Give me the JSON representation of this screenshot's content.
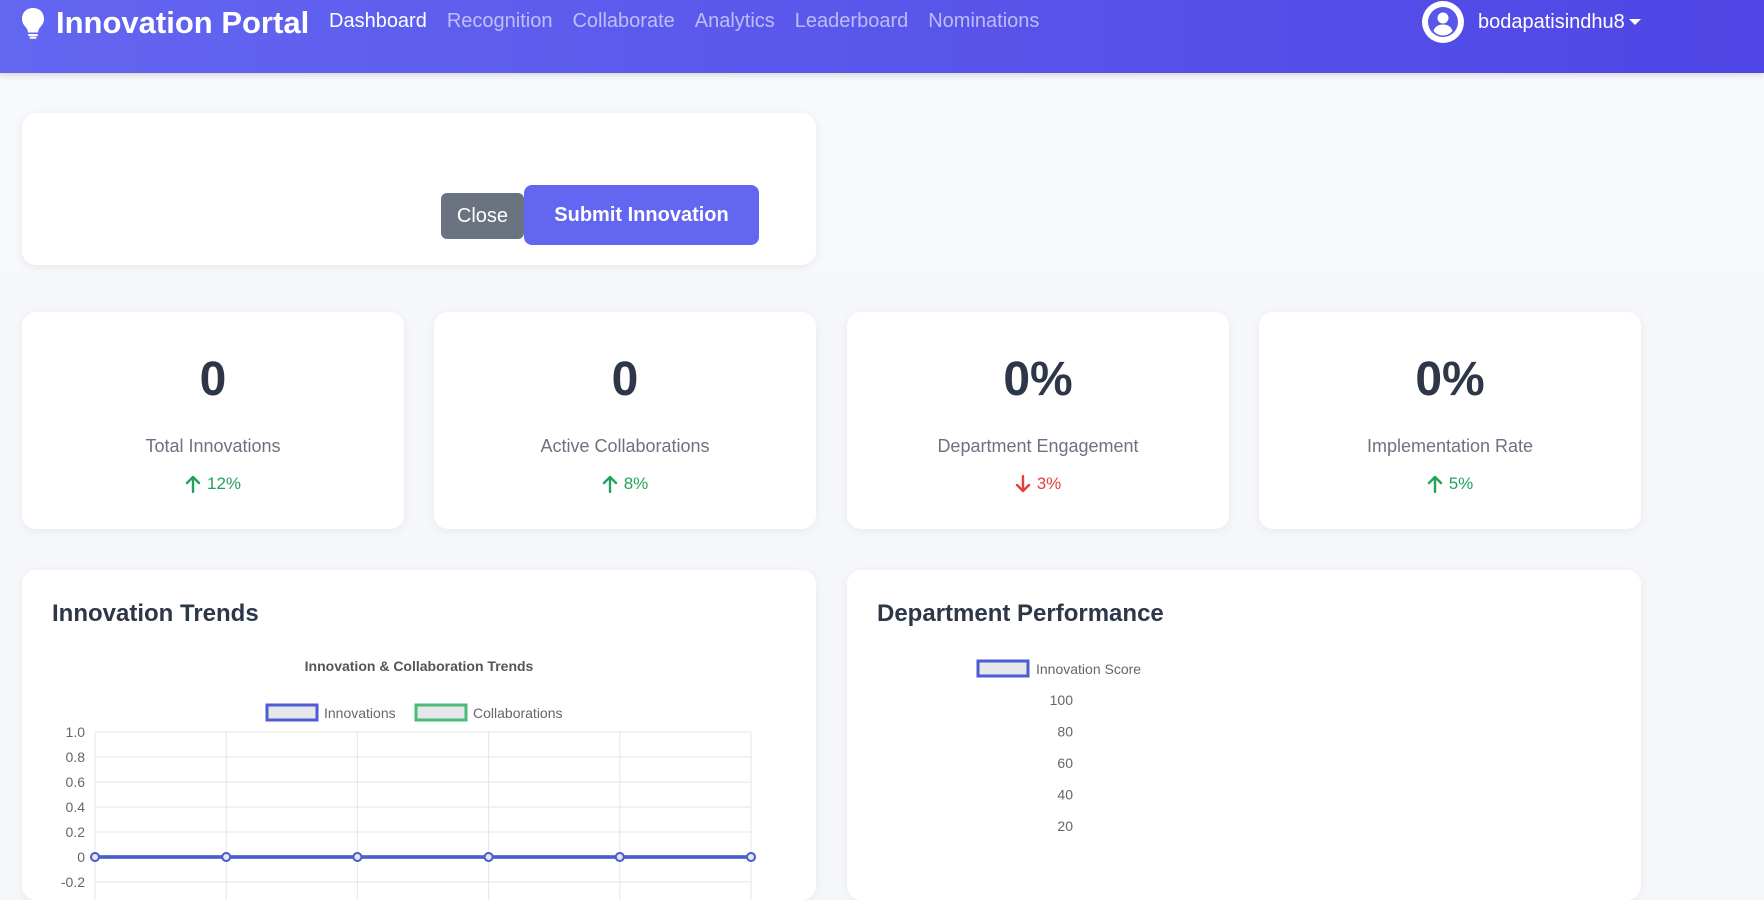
{
  "navbar": {
    "brand": "Innovation Portal",
    "links": [
      "Dashboard",
      "Recognition",
      "Collaborate",
      "Analytics",
      "Leaderboard",
      "Nominations"
    ],
    "active": "Dashboard",
    "username": "bodapatisindhu8"
  },
  "form": {
    "close_label": "Close",
    "submit_label": "Submit Innovation"
  },
  "stats": [
    {
      "value": "0",
      "label": "Total Innovations",
      "change": "12%",
      "direction": "up"
    },
    {
      "value": "0",
      "label": "Active Collaborations",
      "change": "8%",
      "direction": "up"
    },
    {
      "value": "0%",
      "label": "Department Engagement",
      "change": "3%",
      "direction": "down"
    },
    {
      "value": "0%",
      "label": "Implementation Rate",
      "change": "5%",
      "direction": "up"
    }
  ],
  "colors": {
    "accent": "#6366f1",
    "up": "#22a35a",
    "down": "#e53e3e",
    "innovations": "#4f5bd5",
    "collaborations": "#48bb78"
  },
  "trends_card": {
    "heading": "Innovation Trends"
  },
  "dept_card": {
    "heading": "Department Performance"
  },
  "chart_data": [
    {
      "type": "line",
      "title": "Innovation & Collaboration Trends",
      "xlabel": "",
      "ylabel": "",
      "ylim": [
        -0.2,
        1.0
      ],
      "yticks": [
        "1.0",
        "0.8",
        "0.6",
        "0.4",
        "0.2",
        "0",
        "-0.2"
      ],
      "x_count": 6,
      "series": [
        {
          "name": "Innovations",
          "values": [
            0,
            0,
            0,
            0,
            0,
            0
          ]
        },
        {
          "name": "Collaborations",
          "values": [
            0,
            0,
            0,
            0,
            0,
            0
          ]
        }
      ],
      "legend": "top",
      "grid": true
    },
    {
      "type": "bar",
      "title": "",
      "xlabel": "",
      "ylabel": "",
      "yticks": [
        "100",
        "80",
        "60",
        "40",
        "20"
      ],
      "series": [
        {
          "name": "Innovation Score",
          "values": []
        }
      ],
      "legend": "top",
      "grid": false
    }
  ]
}
